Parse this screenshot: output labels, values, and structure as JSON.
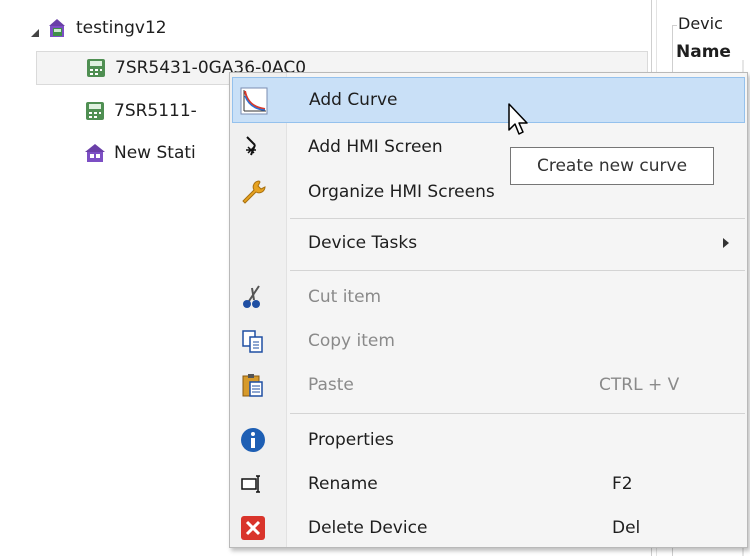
{
  "tree": {
    "root": {
      "label": "testingv12",
      "icon": "station-folder-icon"
    },
    "children": [
      {
        "label": "7SR5431-0GA36-0AC0",
        "icon": "device-icon",
        "selected": true
      },
      {
        "label": "7SR5111-",
        "icon": "device-icon",
        "selected": false
      },
      {
        "label": "New Stati",
        "icon": "station-icon",
        "selected": false
      }
    ]
  },
  "right_panel": {
    "group_title": "Devic",
    "name_label": "Name"
  },
  "context_menu": {
    "items": [
      {
        "label": "Add Curve",
        "icon": "curve-icon",
        "shortcut": "",
        "enabled": true,
        "highlighted": true
      },
      {
        "label": "Add HMI Screen",
        "icon": "hmi-screen-icon",
        "shortcut": "",
        "enabled": true
      },
      {
        "label": "Organize HMI Screens",
        "icon": "wrench-icon",
        "shortcut": "",
        "enabled": true
      },
      {
        "label": "Device Tasks",
        "icon": "",
        "shortcut": "",
        "enabled": true,
        "submenu": true
      },
      {
        "label": "Cut item",
        "icon": "scissors-icon",
        "shortcut": "",
        "enabled": false
      },
      {
        "label": "Copy item",
        "icon": "copy-icon",
        "shortcut": "",
        "enabled": false
      },
      {
        "label": "Paste",
        "icon": "paste-icon",
        "shortcut": "CTRL + V",
        "enabled": false
      },
      {
        "label": "Properties",
        "icon": "info-icon",
        "shortcut": "",
        "enabled": true
      },
      {
        "label": "Rename",
        "icon": "rename-icon",
        "shortcut": "F2",
        "enabled": true
      },
      {
        "label": "Delete Device",
        "icon": "delete-icon",
        "shortcut": "Del",
        "enabled": true
      }
    ]
  },
  "tooltip": {
    "text": "Create new curve"
  },
  "colors": {
    "highlight": "#c9e0f7",
    "highlight_border": "#94c1ed",
    "menu_bg": "#f5f5f5",
    "disabled_text": "#8a8a8a",
    "delete_red": "#d9342b",
    "info_blue": "#1e5fb4"
  }
}
